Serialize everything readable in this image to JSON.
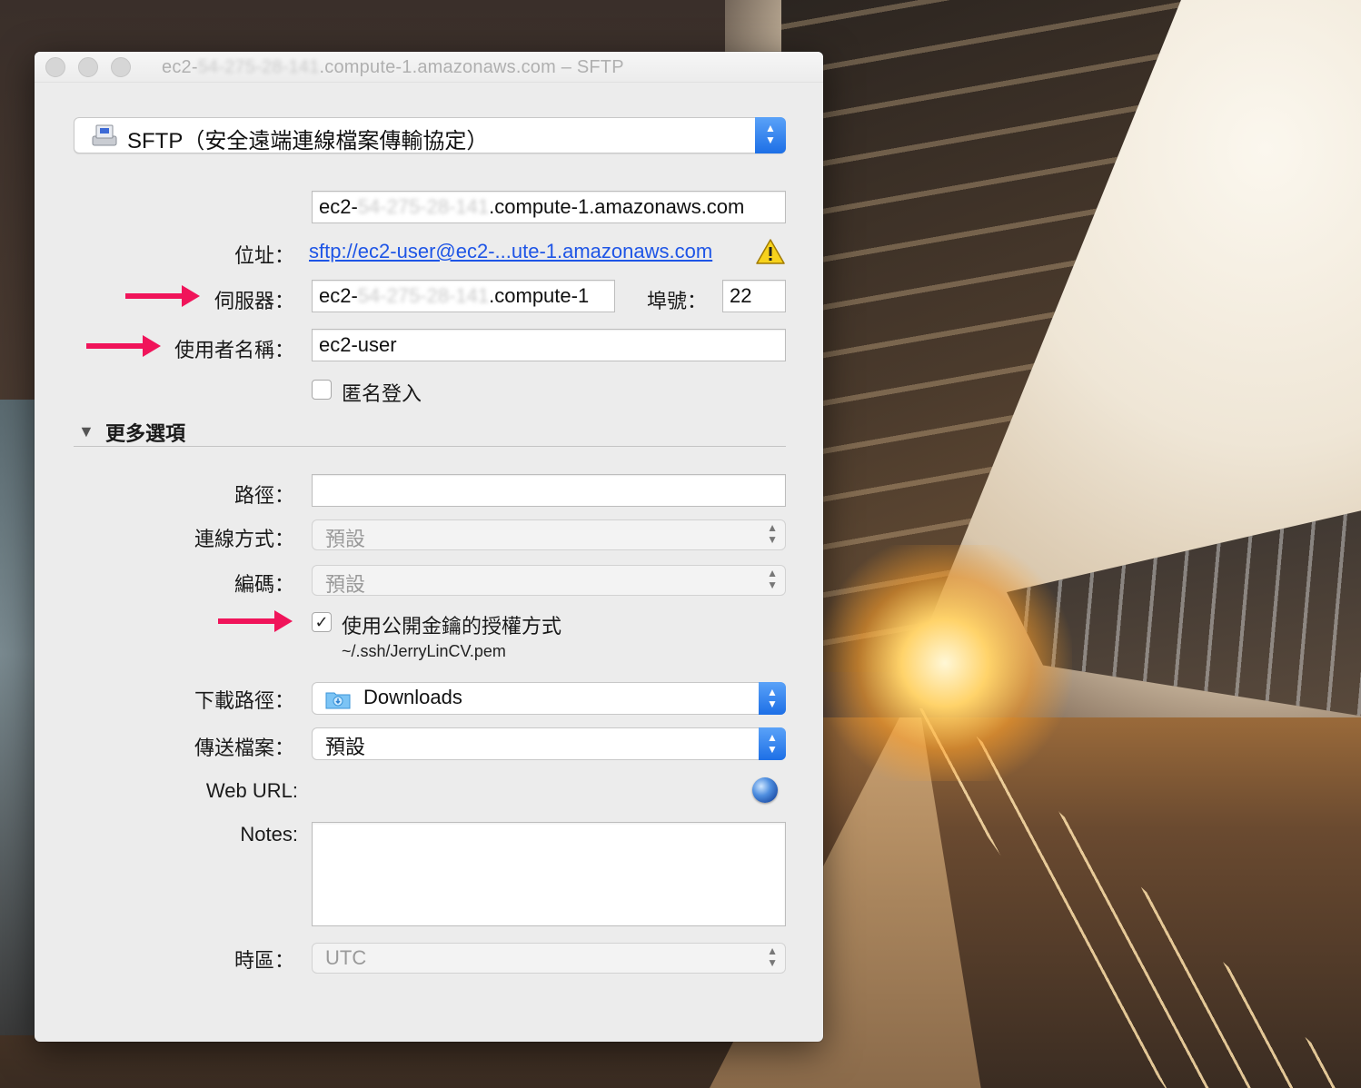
{
  "window": {
    "title_prefix": "ec2-",
    "title_blurred": "54-275-28-141",
    "title_suffix": ".compute-1.amazonaws.com – SFTP"
  },
  "protocol": {
    "label": "SFTP（安全遠端連線檔案傳輸協定）",
    "stepper": "⌃⌄"
  },
  "host_field": {
    "prefix": "ec2-",
    "blurred": "54-275-28-141",
    "suffix": ".compute-1.amazonaws.com"
  },
  "address": {
    "label": "位址：",
    "link": "sftp://ec2-user@ec2-...ute-1.amazonaws.com",
    "warning_icon": "warning-icon"
  },
  "server": {
    "label": "伺服器：",
    "prefix": "ec2-",
    "blurred": "54-275-28-141",
    "suffix": ".compute-1"
  },
  "port": {
    "label": "埠號：",
    "value": "22"
  },
  "username": {
    "label": "使用者名稱：",
    "value": "ec2-user"
  },
  "anonymous": {
    "label": "匿名登入",
    "checked": false
  },
  "more_options": {
    "title": "更多選項",
    "disclosure": "▼"
  },
  "path": {
    "label": "路徑：",
    "value": ""
  },
  "connect_mode": {
    "label": "連線方式：",
    "value": "預設"
  },
  "encoding": {
    "label": "編碼：",
    "value": "預設"
  },
  "public_key": {
    "label": "使用公開金鑰的授權方式",
    "checked": true,
    "check_mark": "✓",
    "path": "~/.ssh/JerryLinCV.pem"
  },
  "download_path": {
    "label": "下載路徑：",
    "value": "Downloads"
  },
  "transfer_files": {
    "label": "傳送檔案：",
    "value": "預設"
  },
  "web_url": {
    "label": "Web URL:"
  },
  "notes": {
    "label": "Notes:",
    "value": ""
  },
  "timezone": {
    "label": "時區：",
    "value": "UTC"
  },
  "colors": {
    "arrow": "#f0145a",
    "link": "#1e55e6",
    "stepper_blue": "#1d6fe6"
  }
}
